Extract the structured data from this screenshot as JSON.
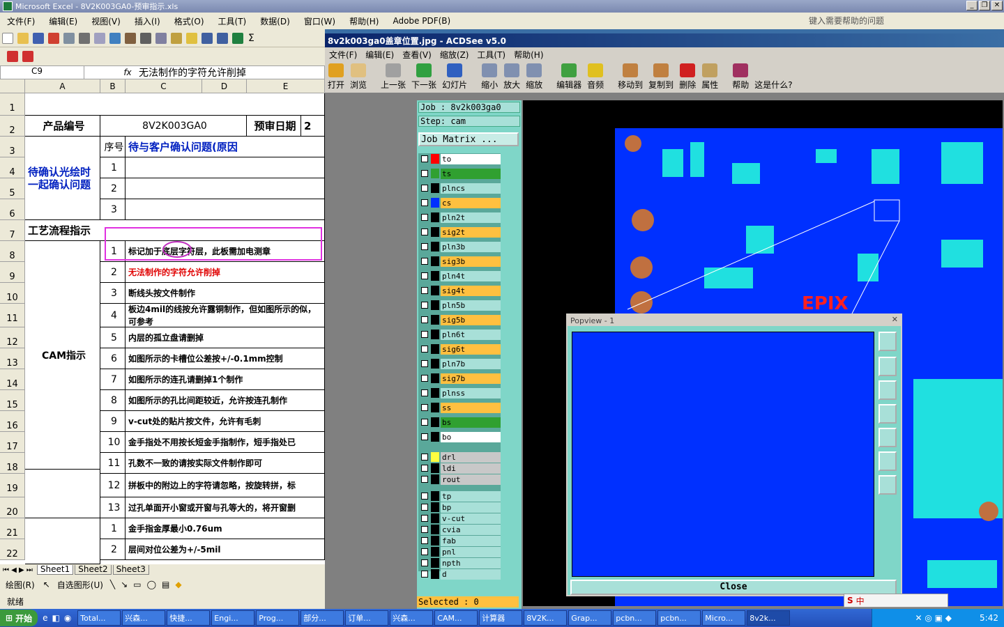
{
  "excel": {
    "title": "Microsoft Excel - 8V2K003GA0-预审指示.xls",
    "menu": [
      "文件(F)",
      "编辑(E)",
      "视图(V)",
      "插入(I)",
      "格式(O)",
      "工具(T)",
      "数据(D)",
      "窗口(W)",
      "帮助(H)",
      "Adobe PDF(B)"
    ],
    "help_placeholder": "键入需要帮助的问题",
    "name_box": "C9",
    "fx": "fx",
    "formula_value": "无法制作的字符允许削掉",
    "columns": [
      "A",
      "B",
      "C",
      "D",
      "E"
    ],
    "rows": [
      "1",
      "2",
      "3",
      "4",
      "5",
      "6",
      "7",
      "8",
      "9",
      "10",
      "11",
      "12",
      "13",
      "14",
      "15",
      "16",
      "17",
      "18",
      "19",
      "20",
      "21",
      "22"
    ],
    "product_label": "产品编号",
    "product_value": "8V2K003GA0",
    "review_date_label": "预审日期",
    "review_date_value": "2",
    "seq_label": "序号",
    "confirm_header": "待与客户确认问题(原因",
    "confirm_group": "待确认光绘时一起确认问题",
    "confirm_rows": [
      "1",
      "2",
      "3"
    ],
    "process_label": "工艺流程指示",
    "cam_label": "CAM指示",
    "cam_items": [
      {
        "no": "1",
        "text": "标记加于底层字符层，此板需加电测章",
        "red": false
      },
      {
        "no": "2",
        "text": "无法制作的字符允许削掉",
        "red": true
      },
      {
        "no": "3",
        "text": "断线头按文件制作",
        "red": false
      },
      {
        "no": "4",
        "text": "板边4mil的线按允许露铜制作，但如图所示的似，可参考",
        "red": false
      },
      {
        "no": "5",
        "text": "内层的孤立盘请删掉",
        "red": false
      },
      {
        "no": "6",
        "text": "如图所示的卡槽位公差按+/-0.1mm控制",
        "red": false
      },
      {
        "no": "7",
        "text": "如图所示的连孔请删掉1个制作",
        "red": false
      },
      {
        "no": "8",
        "text": "如图所示的孔比间距较近，允许按连孔制作",
        "red": false
      },
      {
        "no": "9",
        "text": "v-cut处的贴片按文件，允许有毛刺",
        "red": false
      },
      {
        "no": "10",
        "text": "金手指处不用按长短金手指制作，短手指处已",
        "red": false
      },
      {
        "no": "11",
        "text": "孔数不一致的请按实际文件制作即可",
        "red": false
      },
      {
        "no": "12",
        "text": "拼板中的附边上的字符请忽略，按旋转拼，标",
        "red": false
      },
      {
        "no": "13",
        "text": "过孔单面开小窗或开窗与孔等大的，将开窗删",
        "red": false
      }
    ],
    "process_items": [
      {
        "no": "1",
        "text": "金手指金厚最小0.76um"
      },
      {
        "no": "2",
        "text": "层间对位公差为+/-5mil"
      }
    ],
    "sheet_tabs": [
      "Sheet1",
      "Sheet2",
      "Sheet3"
    ],
    "draw_label": "绘图(R)",
    "autoshape_label": "自选图形(U)",
    "status": "就绪"
  },
  "acdsee": {
    "title": "8v2k003ga0盖章位置.jpg - ACDSee v5.0",
    "menu": [
      "文件(F)",
      "编辑(E)",
      "查看(V)",
      "缩放(Z)",
      "工具(T)",
      "帮助(H)"
    ],
    "toolbar": [
      {
        "label": "打开",
        "color": "#e0a020"
      },
      {
        "label": "浏览",
        "color": "#e0c080"
      },
      {
        "label": "上一张",
        "color": "#a0a0a0"
      },
      {
        "label": "下一张",
        "color": "#30a040"
      },
      {
        "label": "幻灯片",
        "color": "#3060c0"
      },
      {
        "label": "缩小",
        "color": "#8090b0"
      },
      {
        "label": "放大",
        "color": "#8090b0"
      },
      {
        "label": "缩放",
        "color": "#8090b0"
      },
      {
        "label": "编辑器",
        "color": "#40a040"
      },
      {
        "label": "音频",
        "color": "#e0c020"
      },
      {
        "label": "移动到",
        "color": "#c08040"
      },
      {
        "label": "复制到",
        "color": "#c08040"
      },
      {
        "label": "删除",
        "color": "#d02020"
      },
      {
        "label": "属性",
        "color": "#c0a060"
      },
      {
        "label": "帮助",
        "color": "#a03060"
      },
      {
        "label": "这是什么?",
        "color": "#d4d0c8"
      }
    ]
  },
  "genesis": {
    "job": "Job : 8v2k003ga0",
    "step": "Step: cam",
    "job_matrix": "Job Matrix ...",
    "selected": "Selected : 0",
    "layers": [
      {
        "name": "to",
        "swatch": "#ff0000",
        "bg": "#ffffff"
      },
      {
        "name": "ts",
        "swatch": "#30a030",
        "bg": "#30a030"
      },
      {
        "name": "plncs",
        "swatch": "#000000",
        "bg": "#a8e0d8"
      },
      {
        "name": "cs",
        "swatch": "#0030ff",
        "bg": "#ffc040"
      },
      {
        "name": "pln2t",
        "swatch": "#000000",
        "bg": "#a8e0d8"
      },
      {
        "name": "sig2t",
        "swatch": "#000000",
        "bg": "#ffc040"
      },
      {
        "name": "pln3b",
        "swatch": "#000000",
        "bg": "#a8e0d8"
      },
      {
        "name": "sig3b",
        "swatch": "#000000",
        "bg": "#ffc040"
      },
      {
        "name": "pln4t",
        "swatch": "#000000",
        "bg": "#a8e0d8"
      },
      {
        "name": "sig4t",
        "swatch": "#000000",
        "bg": "#ffc040"
      },
      {
        "name": "pln5b",
        "swatch": "#000000",
        "bg": "#a8e0d8"
      },
      {
        "name": "sig5b",
        "swatch": "#000000",
        "bg": "#ffc040"
      },
      {
        "name": "pln6t",
        "swatch": "#000000",
        "bg": "#a8e0d8"
      },
      {
        "name": "sig6t",
        "swatch": "#000000",
        "bg": "#ffc040"
      },
      {
        "name": "pln7b",
        "swatch": "#000000",
        "bg": "#a8e0d8"
      },
      {
        "name": "sig7b",
        "swatch": "#000000",
        "bg": "#ffc040"
      },
      {
        "name": "plnss",
        "swatch": "#000000",
        "bg": "#a8e0d8"
      },
      {
        "name": "ss",
        "swatch": "#000000",
        "bg": "#ffc040"
      },
      {
        "name": "bs",
        "swatch": "#000000",
        "bg": "#30a030"
      },
      {
        "name": "bo",
        "swatch": "#000000",
        "bg": "#ffffff"
      },
      {
        "name": "drl",
        "swatch": "#ffff40",
        "bg": "#c8c8c8"
      },
      {
        "name": "ldi",
        "swatch": "#000000",
        "bg": "#c8c8c8"
      },
      {
        "name": "rout",
        "swatch": "#000000",
        "bg": "#c8c8c8"
      },
      {
        "name": "tp",
        "swatch": "#000000",
        "bg": "#a8e0d8"
      },
      {
        "name": "bp",
        "swatch": "#000000",
        "bg": "#a8e0d8"
      },
      {
        "name": "v-cut",
        "swatch": "#000000",
        "bg": "#a8e0d8"
      },
      {
        "name": "cvia",
        "swatch": "#000000",
        "bg": "#a8e0d8"
      },
      {
        "name": "fab",
        "swatch": "#000000",
        "bg": "#a8e0d8"
      },
      {
        "name": "pnl",
        "swatch": "#000000",
        "bg": "#a8e0d8"
      },
      {
        "name": "npth",
        "swatch": "#000000",
        "bg": "#a8e0d8"
      },
      {
        "name": "d",
        "swatch": "#000000",
        "bg": "#a8e0d8"
      }
    ],
    "board_text": "EPIX",
    "popview_title": "Popview - 1",
    "popview_close": "Close"
  },
  "taskbar": {
    "start": "开始",
    "items": [
      "Total...",
      "兴森...",
      "快捷...",
      "Engi...",
      "Prog...",
      "部分...",
      "订单...",
      "兴森...",
      "CAM...",
      "计算器",
      "8V2K...",
      "Grap...",
      "pcbn...",
      "pcbn...",
      "Micro...",
      "8v2k..."
    ],
    "clock": "5:42",
    "ime": "中"
  }
}
